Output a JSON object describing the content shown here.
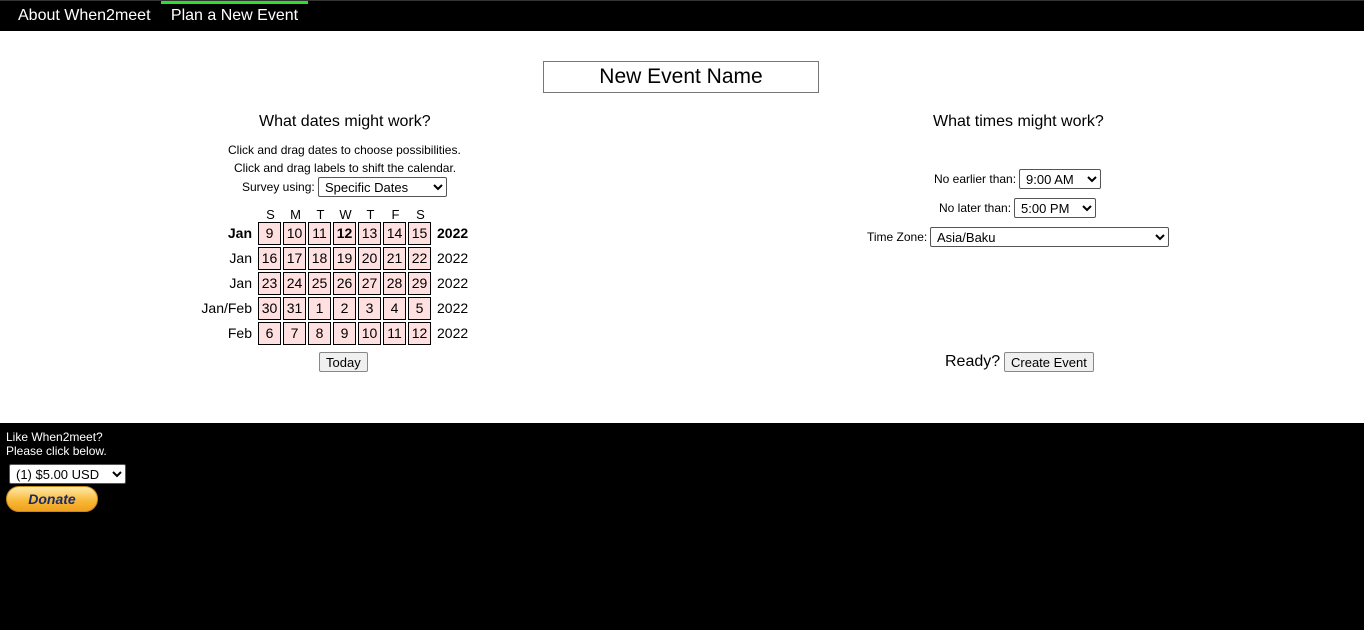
{
  "nav": {
    "about": "About When2meet",
    "plan": "Plan a New Event"
  },
  "event": {
    "name": "New Event Name"
  },
  "dates": {
    "heading": "What dates might work?",
    "instruction1": "Click and drag dates to choose possibilities.",
    "instruction2": "Click and drag labels to shift the calendar.",
    "survey_label": "Survey using:",
    "survey_value": "Specific Dates",
    "weekdays": [
      "S",
      "M",
      "T",
      "W",
      "T",
      "F",
      "S"
    ],
    "rows": [
      {
        "month": "Jan",
        "days": [
          "9",
          "10",
          "11",
          "12",
          "13",
          "14",
          "15"
        ],
        "year": "2022"
      },
      {
        "month": "Jan",
        "days": [
          "16",
          "17",
          "18",
          "19",
          "20",
          "21",
          "22"
        ],
        "year": "2022"
      },
      {
        "month": "Jan",
        "days": [
          "23",
          "24",
          "25",
          "26",
          "27",
          "28",
          "29"
        ],
        "year": "2022"
      },
      {
        "month": "Jan/Feb",
        "days": [
          "30",
          "31",
          "1",
          "2",
          "3",
          "4",
          "5"
        ],
        "year": "2022"
      },
      {
        "month": "Feb",
        "days": [
          "6",
          "7",
          "8",
          "9",
          "10",
          "11",
          "12"
        ],
        "year": "2022"
      }
    ],
    "today_label": "Today"
  },
  "times": {
    "heading": "What times might work?",
    "earliest_label": "No earlier than:",
    "earliest_value": "9:00 AM",
    "latest_label": "No later than:",
    "latest_value": "5:00 PM",
    "timezone_label": "Time Zone:",
    "timezone_value": "Asia/Baku",
    "ready_label": "Ready?",
    "create_label": "Create Event"
  },
  "footer": {
    "line1": "Like When2meet?",
    "line2": "Please click below.",
    "donation_value": "(1) $5.00 USD",
    "donate_label": "Donate"
  },
  "colors": {
    "accent": "#2bdf2b",
    "date_cell": "#ffe0e0"
  }
}
